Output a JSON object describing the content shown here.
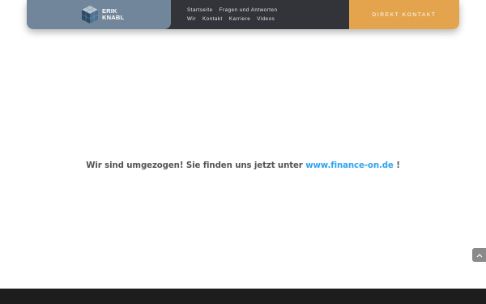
{
  "header": {
    "brand": {
      "line1": "ERIK",
      "line2": "KNABL"
    },
    "nav": {
      "row1": [
        "Startseite",
        "Fragen und Antworten"
      ],
      "row2": [
        "Wir",
        "Kontakt",
        "Karriere",
        "Videos"
      ]
    },
    "cta_label": "DIREKT KONTAKT"
  },
  "main": {
    "message_before": "Wir sind umgezogen! Sie finden uns jetzt unter ",
    "link_text": "www.finance-on.de",
    "message_after": " !"
  },
  "icons": {
    "logo": "cube-logo-icon",
    "scroll_top": "chevron-up-icon"
  },
  "colors": {
    "brand_bg": "#71869a",
    "nav_bg": "#33343a",
    "cta_bg": "#e4a44d",
    "link": "#2ea3f2",
    "text": "#545454",
    "footer": "#1d1d1d"
  }
}
